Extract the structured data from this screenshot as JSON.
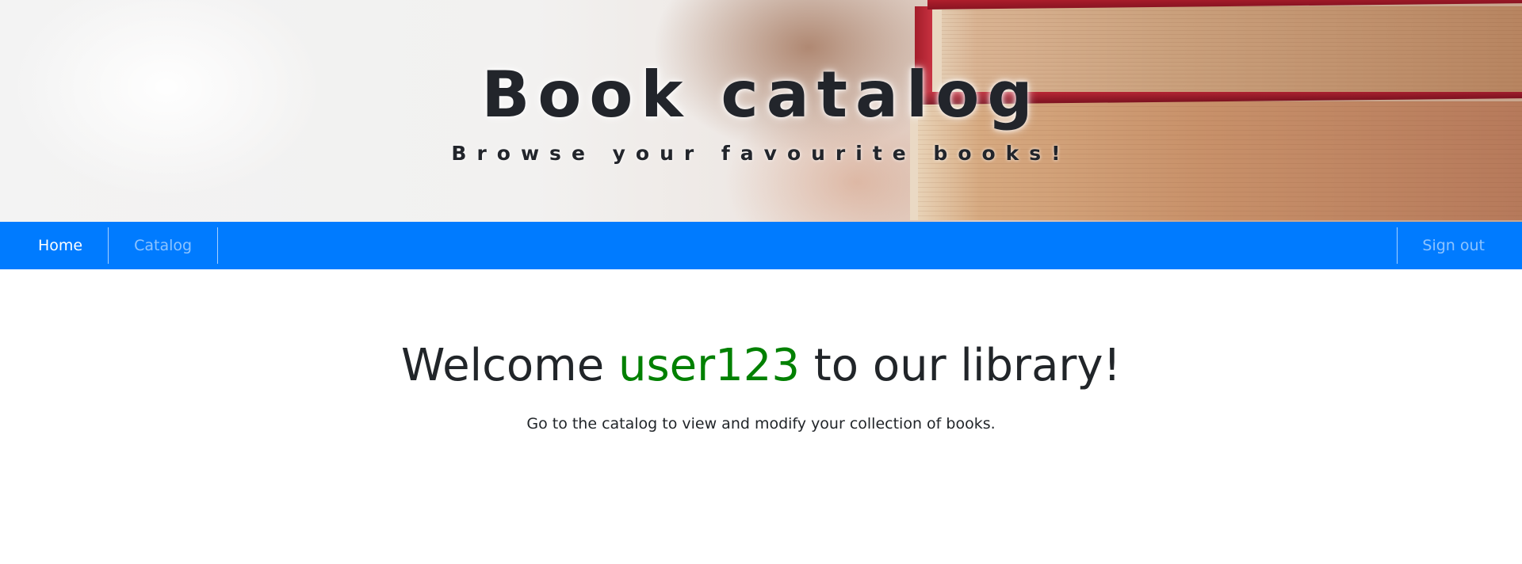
{
  "header": {
    "title": "Book catalog",
    "subtitle": "Browse your favourite books!"
  },
  "nav": {
    "home_label": "Home",
    "catalog_label": "Catalog",
    "signout_label": "Sign out"
  },
  "main": {
    "welcome_prefix": "Welcome",
    "username": "user123",
    "welcome_suffix": "to our library!",
    "lead_text": "Go to the catalog to view and modify your collection of books."
  },
  "colors": {
    "navbar": "#007bff",
    "username": "#008000",
    "text": "#212529"
  }
}
